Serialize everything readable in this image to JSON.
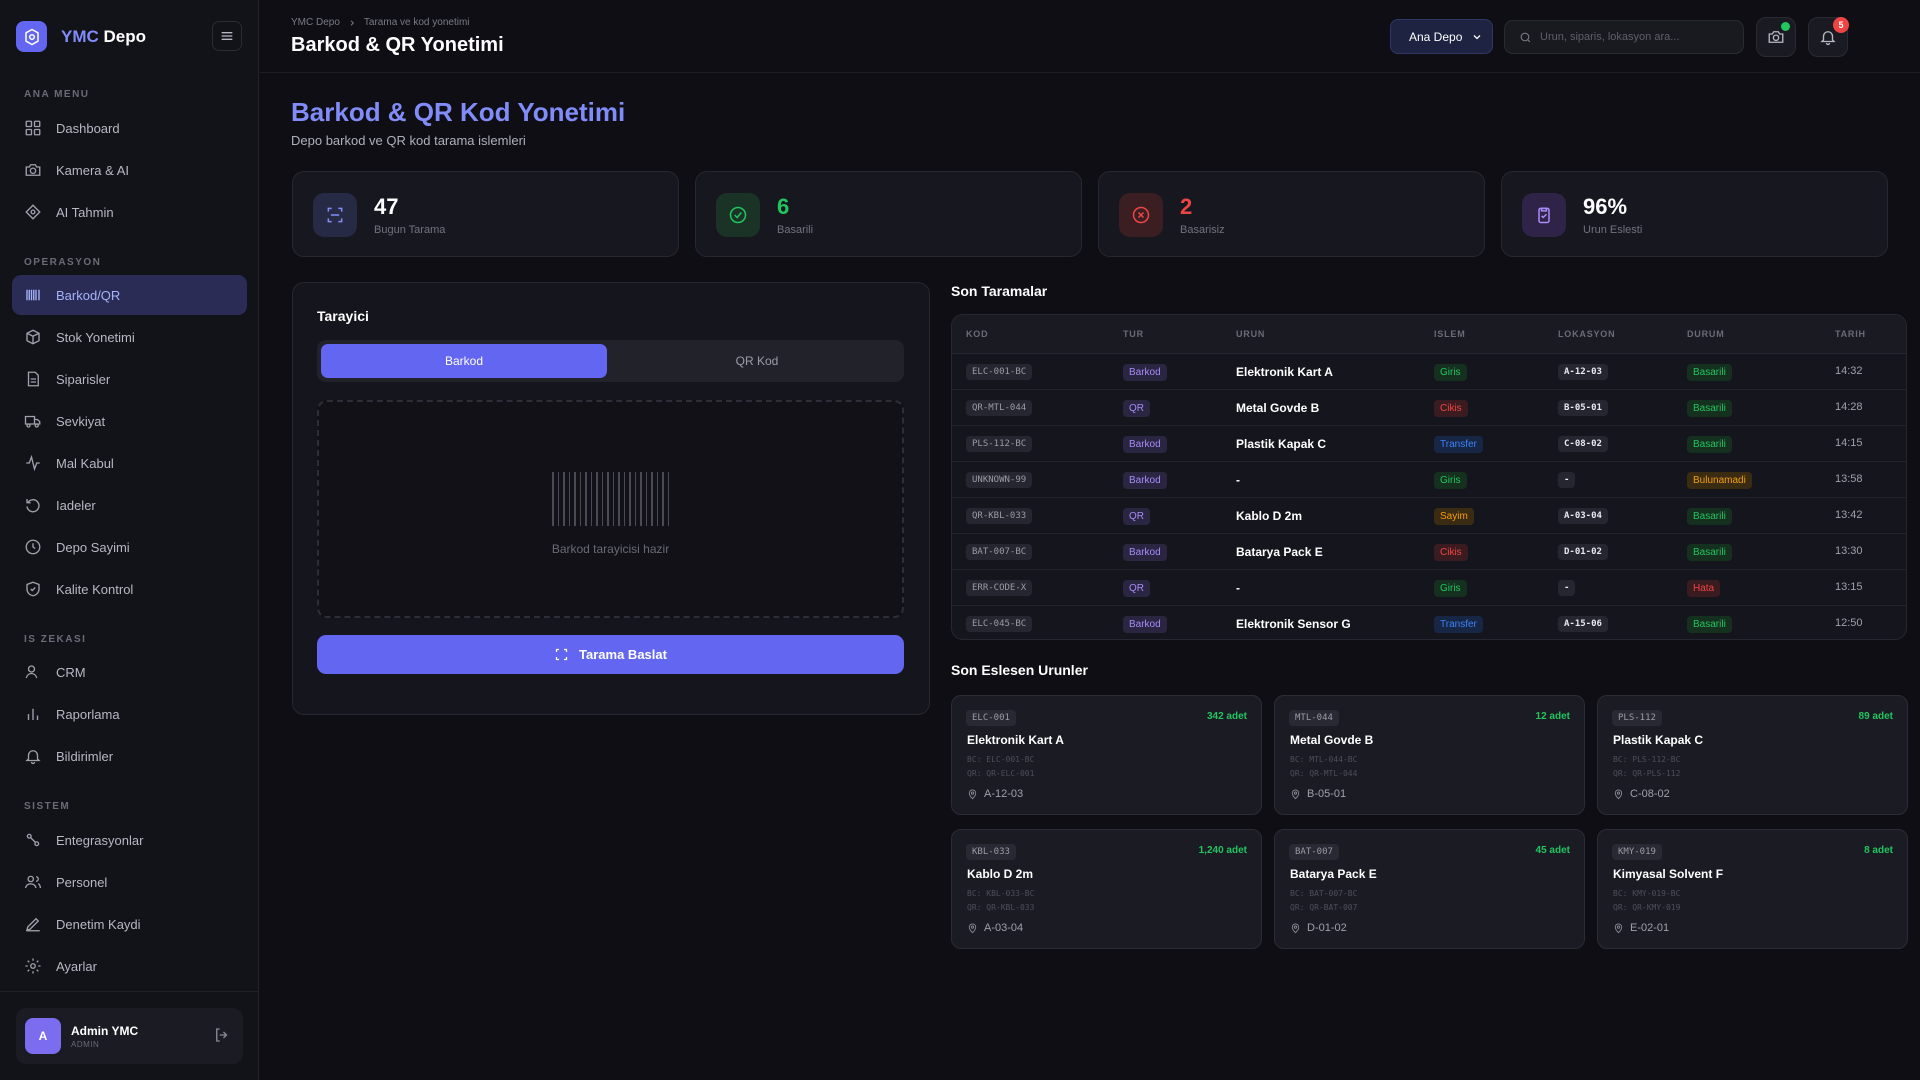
{
  "app": {
    "name_accent": "YMC",
    "name_rest": "Depo"
  },
  "sidebar": {
    "sections": [
      {
        "title": "ANA MENU"
      },
      {
        "title": "OPERASYON"
      },
      {
        "title": "IS ZEKASI"
      },
      {
        "title": "SISTEM"
      }
    ],
    "items": [
      {
        "label": "Dashboard",
        "icon": "dashboard-icon"
      },
      {
        "label": "Kamera & AI",
        "icon": "camera-icon"
      },
      {
        "label": "AI Tahmin",
        "icon": "ai-icon"
      },
      {
        "label": "Barkod/QR",
        "icon": "barcode-icon",
        "active": true
      },
      {
        "label": "Stok Yonetimi",
        "icon": "box-icon"
      },
      {
        "label": "Siparisler",
        "icon": "document-icon"
      },
      {
        "label": "Sevkiyat",
        "icon": "truck-icon"
      },
      {
        "label": "Mal Kabul",
        "icon": "activity-icon"
      },
      {
        "label": "Iadeler",
        "icon": "return-icon"
      },
      {
        "label": "Depo Sayimi",
        "icon": "clock-icon"
      },
      {
        "label": "Kalite Kontrol",
        "icon": "shield-icon"
      },
      {
        "label": "CRM",
        "icon": "user-icon"
      },
      {
        "label": "Raporlama",
        "icon": "chart-icon"
      },
      {
        "label": "Bildirimler",
        "icon": "bell-icon"
      },
      {
        "label": "Entegrasyonlar",
        "icon": "integration-icon"
      },
      {
        "label": "Personel",
        "icon": "users-icon"
      },
      {
        "label": "Denetim Kaydi",
        "icon": "pen-icon"
      },
      {
        "label": "Ayarlar",
        "icon": "gear-icon"
      }
    ],
    "user": {
      "initial": "A",
      "name": "Admin YMC",
      "role": "ADMIN"
    }
  },
  "header": {
    "breadcrumb": [
      "YMC Depo",
      "Tarama ve kod yonetimi"
    ],
    "title": "Barkod & QR Yonetimi",
    "warehouse_select": "Ana Depo",
    "search_placeholder": "Urun, siparis, lokasyon ara...",
    "notification_count": "5"
  },
  "page": {
    "title": "Barkod & QR Kod Yonetimi",
    "subtitle": "Depo barkod ve QR kod tarama islemleri"
  },
  "stats": [
    {
      "value": "47",
      "label": "Bugun Tarama",
      "color": "#ffffff"
    },
    {
      "value": "6",
      "label": "Basarili",
      "color": "#22c55e"
    },
    {
      "value": "2",
      "label": "Basarisiz",
      "color": "#ef4444"
    },
    {
      "value": "96%",
      "label": "Urun Eslesti",
      "color": "#ffffff"
    }
  ],
  "scanner": {
    "title": "Tarayici",
    "tabs": [
      "Barkod",
      "QR Kod"
    ],
    "status": "Barkod tarayicisi hazir",
    "start_button": "Tarama Baslat"
  },
  "recent_scans": {
    "title": "Son Taramalar",
    "columns": [
      "KOD",
      "TUR",
      "URUN",
      "ISLEM",
      "LOKASYON",
      "DURUM",
      "TARIH"
    ],
    "rows": [
      {
        "code": "ELC-001-BC",
        "type": "Barkod",
        "product": "Elektronik Kart A",
        "op": "Giris",
        "loc": "A-12-03",
        "status": "Basarili",
        "time": "14:32"
      },
      {
        "code": "QR-MTL-044",
        "type": "QR",
        "product": "Metal Govde B",
        "op": "Cikis",
        "loc": "B-05-01",
        "status": "Basarili",
        "time": "14:28"
      },
      {
        "code": "PLS-112-BC",
        "type": "Barkod",
        "product": "Plastik Kapak C",
        "op": "Transfer",
        "loc": "C-08-02",
        "status": "Basarili",
        "time": "14:15"
      },
      {
        "code": "UNKNOWN-99",
        "type": "Barkod",
        "product": "-",
        "op": "Giris",
        "loc": "-",
        "status": "Bulunamadi",
        "time": "13:58"
      },
      {
        "code": "QR-KBL-033",
        "type": "QR",
        "product": "Kablo D 2m",
        "op": "Sayim",
        "loc": "A-03-04",
        "status": "Basarili",
        "time": "13:42"
      },
      {
        "code": "BAT-007-BC",
        "type": "Barkod",
        "product": "Batarya Pack E",
        "op": "Cikis",
        "loc": "D-01-02",
        "status": "Basarili",
        "time": "13:30"
      },
      {
        "code": "ERR-CODE-X",
        "type": "QR",
        "product": "-",
        "op": "Giris",
        "loc": "-",
        "status": "Hata",
        "time": "13:15"
      },
      {
        "code": "ELC-045-BC",
        "type": "Barkod",
        "product": "Elektronik Sensor G",
        "op": "Transfer",
        "loc": "A-15-06",
        "status": "Basarili",
        "time": "12:50"
      }
    ]
  },
  "matched": {
    "title": "Son Eslesen Urunler",
    "cards": [
      {
        "code": "ELC-001",
        "qty": "342 adet",
        "name": "Elektronik Kart A",
        "bc": "BC: ELC-001-BC",
        "qr": "QR: QR-ELC-001",
        "loc": "A-12-03"
      },
      {
        "code": "MTL-044",
        "qty": "12 adet",
        "name": "Metal Govde B",
        "bc": "BC: MTL-044-BC",
        "qr": "QR: QR-MTL-044",
        "loc": "B-05-01"
      },
      {
        "code": "PLS-112",
        "qty": "89 adet",
        "name": "Plastik Kapak C",
        "bc": "BC: PLS-112-BC",
        "qr": "QR: QR-PLS-112",
        "loc": "C-08-02"
      },
      {
        "code": "KBL-033",
        "qty": "1,240 adet",
        "name": "Kablo D 2m",
        "bc": "BC: KBL-033-BC",
        "qr": "QR: QR-KBL-033",
        "loc": "A-03-04"
      },
      {
        "code": "BAT-007",
        "qty": "45 adet",
        "name": "Batarya Pack E",
        "bc": "BC: BAT-007-BC",
        "qr": "QR: QR-BAT-007",
        "loc": "D-01-02"
      },
      {
        "code": "KMY-019",
        "qty": "8 adet",
        "name": "Kimyasal Solvent F",
        "bc": "BC: KMY-019-BC",
        "qr": "QR: QR-KMY-019",
        "loc": "E-02-01"
      }
    ]
  },
  "colors": {
    "accent": "#6366f1",
    "success": "#22c55e",
    "danger": "#ef4444",
    "warning": "#f59e0b",
    "info": "#3b82f6",
    "purple": "#a78bfa"
  }
}
